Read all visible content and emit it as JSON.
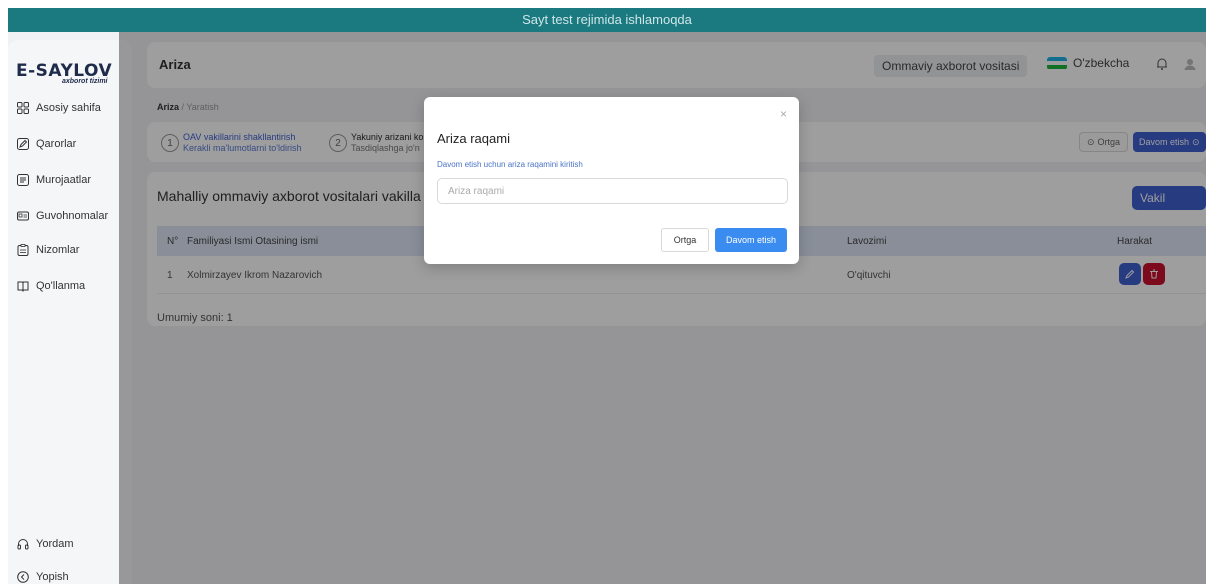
{
  "banner": "Sayt test rejimida ishlamoqda",
  "logo": {
    "text": "E-SAYLOV",
    "tagline": "axborot tizimi"
  },
  "sidebar": {
    "items": [
      {
        "label": "Asosiy sahifa",
        "icon": "grid-icon"
      },
      {
        "label": "Qarorlar",
        "icon": "edit-icon"
      },
      {
        "label": "Murojaatlar",
        "icon": "document-icon"
      },
      {
        "label": "Guvohnomalar",
        "icon": "id-card-icon"
      },
      {
        "label": "Nizomlar",
        "icon": "clipboard-icon"
      },
      {
        "label": "Qo'llanma",
        "icon": "book-icon"
      }
    ],
    "bottom": [
      {
        "label": "Yordam",
        "icon": "headphones-icon"
      },
      {
        "label": "Yopish",
        "icon": "collapse-icon"
      }
    ]
  },
  "header": {
    "title": "Ariza",
    "role_chip": "Ommaviy axborot vositasi",
    "language": "O'zbekcha"
  },
  "breadcrumb": {
    "current": "Ariza",
    "sep": "/",
    "child": "Yaratish"
  },
  "steps": [
    {
      "num": "1",
      "title": "OAV vakillarini shakllantirish",
      "desc": "Kerakli ma'lumotlarni to'ldirish"
    },
    {
      "num": "2",
      "title": "Yakuniy arizani ko",
      "desc": "Tasdiqlashga jo'n"
    }
  ],
  "steps_buttons": {
    "back": "Ortga",
    "next": "Davom etish"
  },
  "card": {
    "title": "Mahalliy ommaviy axborot vositalari vakilla",
    "add_button": "Vakil qo'shish",
    "columns": {
      "num": "N°",
      "name": "Familiyasi Ismi Otasining ismi",
      "position": "Lavozimi",
      "actions": "Harakat"
    },
    "rows": [
      {
        "num": "1",
        "name": "Xolmirzayev Ikrom Nazarovich",
        "position": "O'qituvchi"
      }
    ],
    "total": "Umumiy soni: 1"
  },
  "modal": {
    "title": "Ariza raqami",
    "label": "Davom etish uchun ariza raqamini kiritish",
    "placeholder": "Ariza raqami",
    "cancel": "Ortga",
    "submit": "Davom etish",
    "close_symbol": "×"
  },
  "colors": {
    "banner": "#1b7a80",
    "primary": "#3f5fd1",
    "modal_primary": "#3b8cf0",
    "danger": "#c8102e"
  }
}
